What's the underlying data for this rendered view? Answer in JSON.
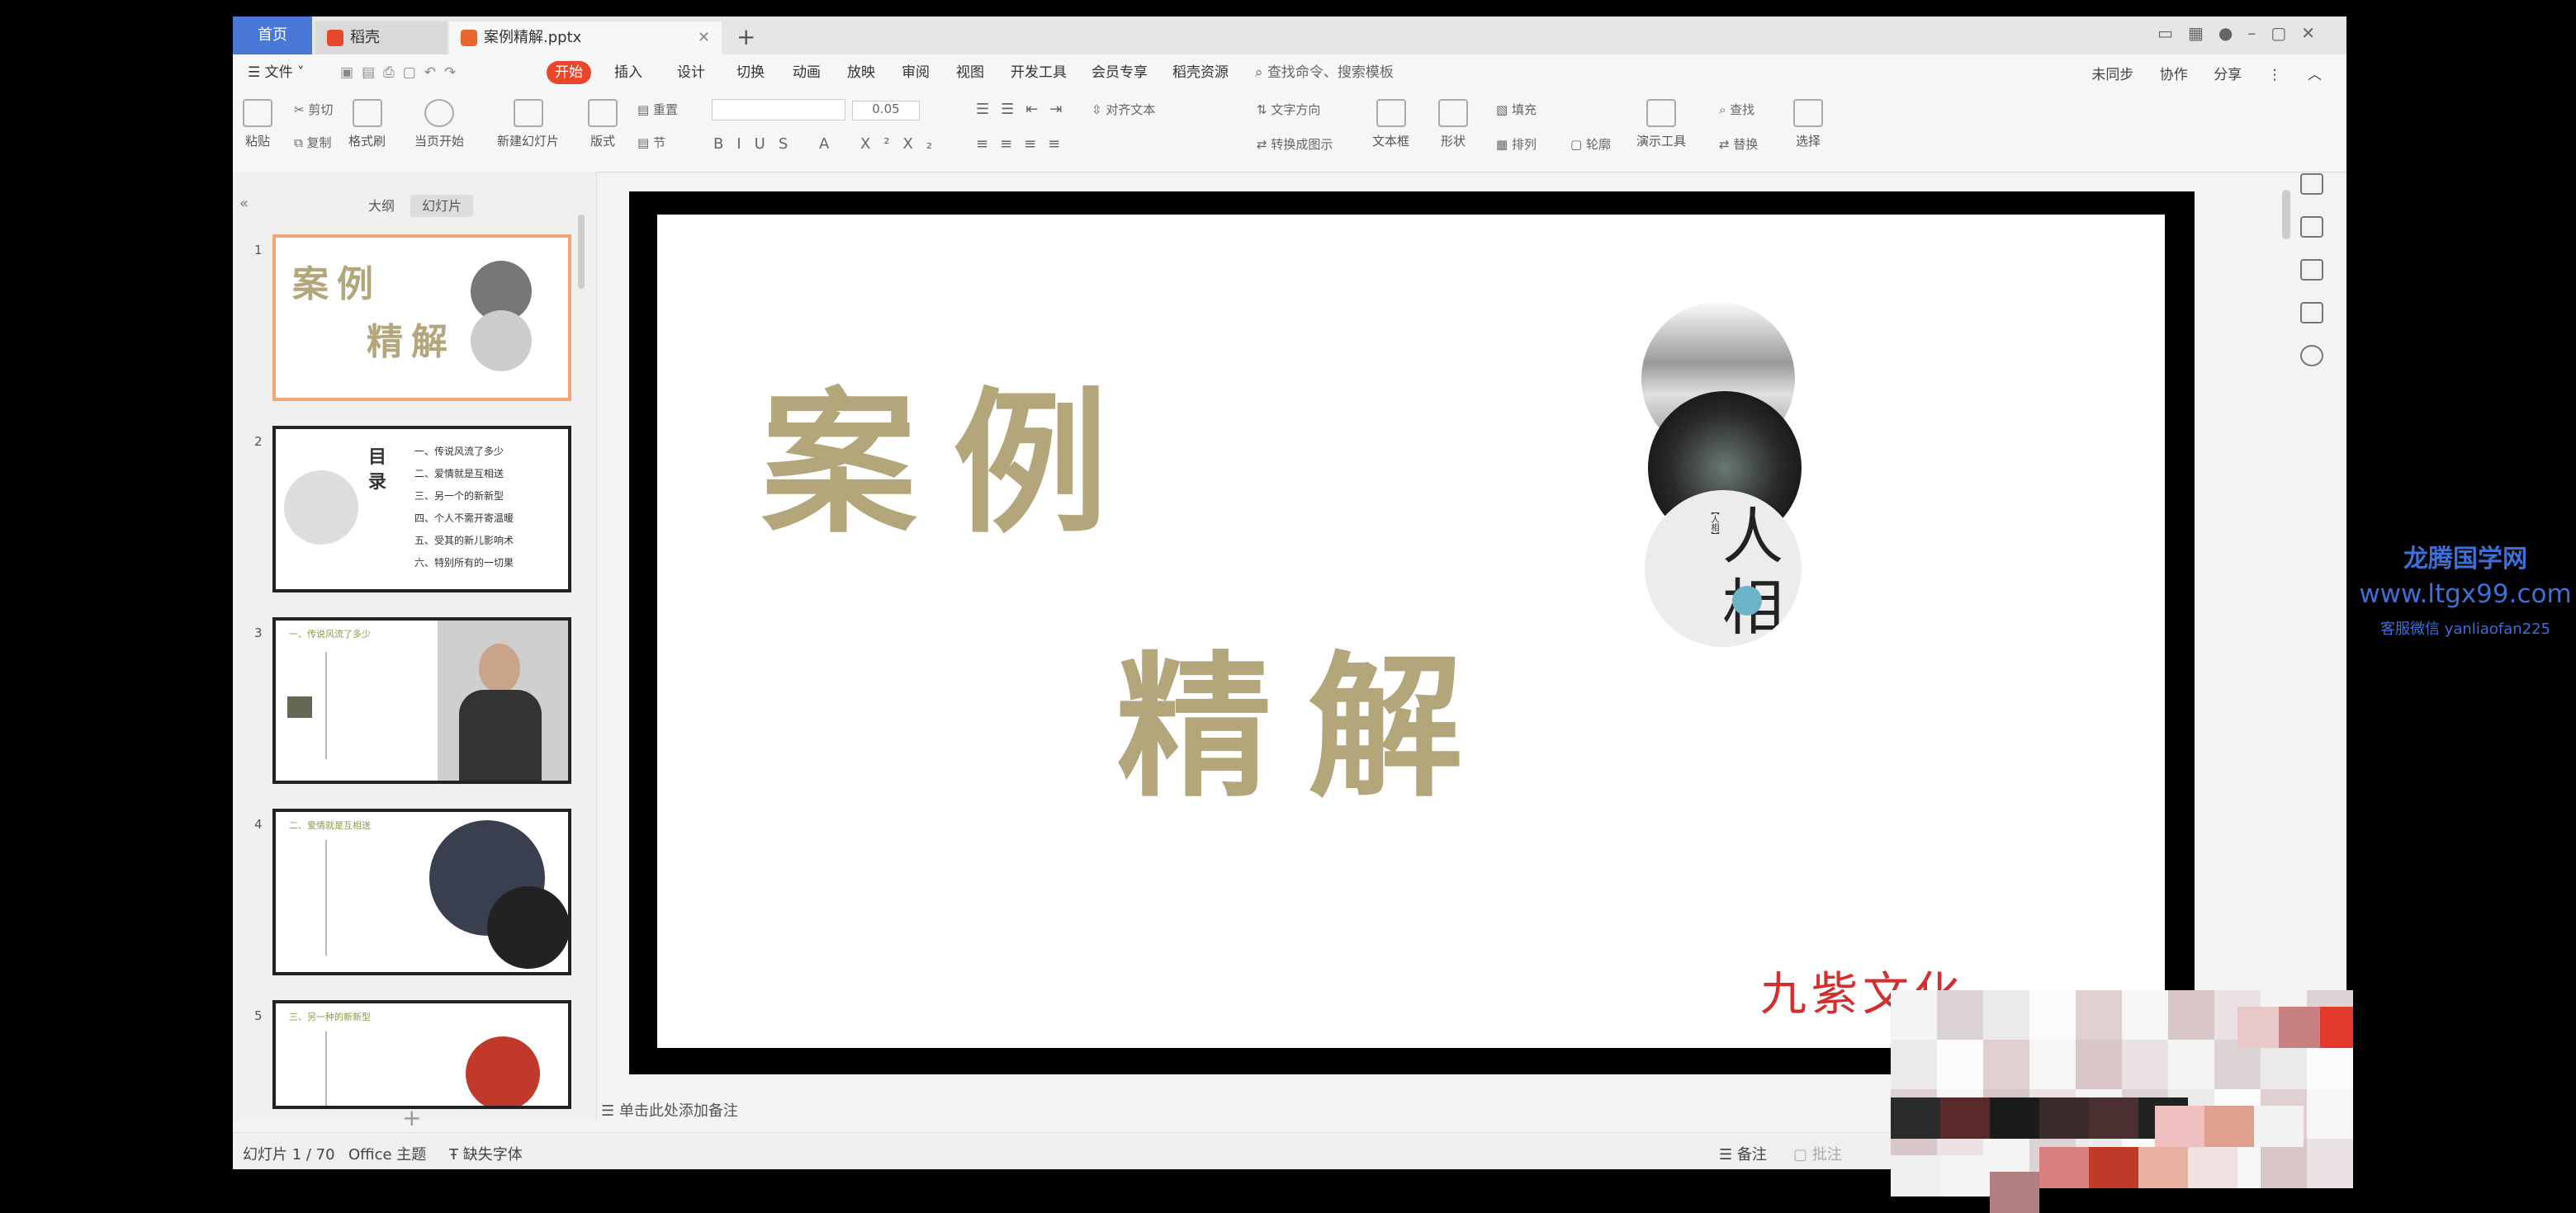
{
  "tabs": {
    "home": "首页",
    "docer": "稻壳",
    "document": "案例精解.pptx",
    "add": "+"
  },
  "menu": {
    "file": "文件",
    "items": [
      "开始",
      "插入",
      "设计",
      "切换",
      "动画",
      "放映",
      "审阅",
      "视图",
      "开发工具",
      "会员专享",
      "稻壳资源"
    ],
    "active_index": 0,
    "search_placeholder": "查找命令、搜索模板",
    "right": [
      "未同步",
      "协作",
      "分享"
    ]
  },
  "ribbon": {
    "paste": "粘贴",
    "cut": "剪切",
    "copy": "复制",
    "format_painter": "格式刷",
    "play_from_start": "当页开始",
    "new_slide": "新建幻灯片",
    "layout": "版式",
    "section": "节",
    "reset": "重置",
    "font_size_step": "0.05",
    "text_box": "文本框",
    "shape": "形状",
    "arrange": "排列",
    "outline": "轮廓",
    "fill": "填充",
    "presentation_tool": "演示工具",
    "find": "查找",
    "replace": "替换",
    "select": "选择",
    "convert_to_art": "转换成图示",
    "text_direction": "文字方向",
    "align_text": "对齐文本"
  },
  "panel": {
    "outline_tab": "大纲",
    "slides_tab": "幻灯片",
    "add": "+"
  },
  "thumbnails": {
    "nums": [
      "1",
      "2",
      "3",
      "4",
      "5"
    ],
    "s1_line1": "案例",
    "s1_line2": "精解",
    "s2_title": "目录",
    "s2_items": [
      "一、传说风流了多少",
      "二、爱情就是互相送",
      "三、另一个的新新型",
      "四、个人不需开寄温暖",
      "五、受其的新儿影响术",
      "六、特别所有的一切果"
    ],
    "s3_title": "一、传说风流了多少",
    "s4_title": "二、爱情就是互相送",
    "s5_title": "三、另一种的新新型"
  },
  "slide": {
    "title_line1": "案例",
    "title_line2": "精解",
    "image_label": "【人相】",
    "image_glyph": "人相",
    "overlay_text": "九紫文化"
  },
  "notes": {
    "placeholder": "单击此处添加备注"
  },
  "status": {
    "slide_counter": "幻灯片 1 / 70",
    "theme": "Office 主题",
    "missing_font": "缺失字体",
    "notes_btn": "备注",
    "comments_btn": "批注"
  },
  "watermark": {
    "title": "龙腾国学网",
    "url": "www.ltgx99.com",
    "contact": "客服微信 yanliaofan225"
  },
  "colors": {
    "accent": "#e8472c",
    "title_gold": "#b3a67a",
    "tab_blue": "#4a78d6",
    "watermark_blue": "#3d6fd6"
  }
}
